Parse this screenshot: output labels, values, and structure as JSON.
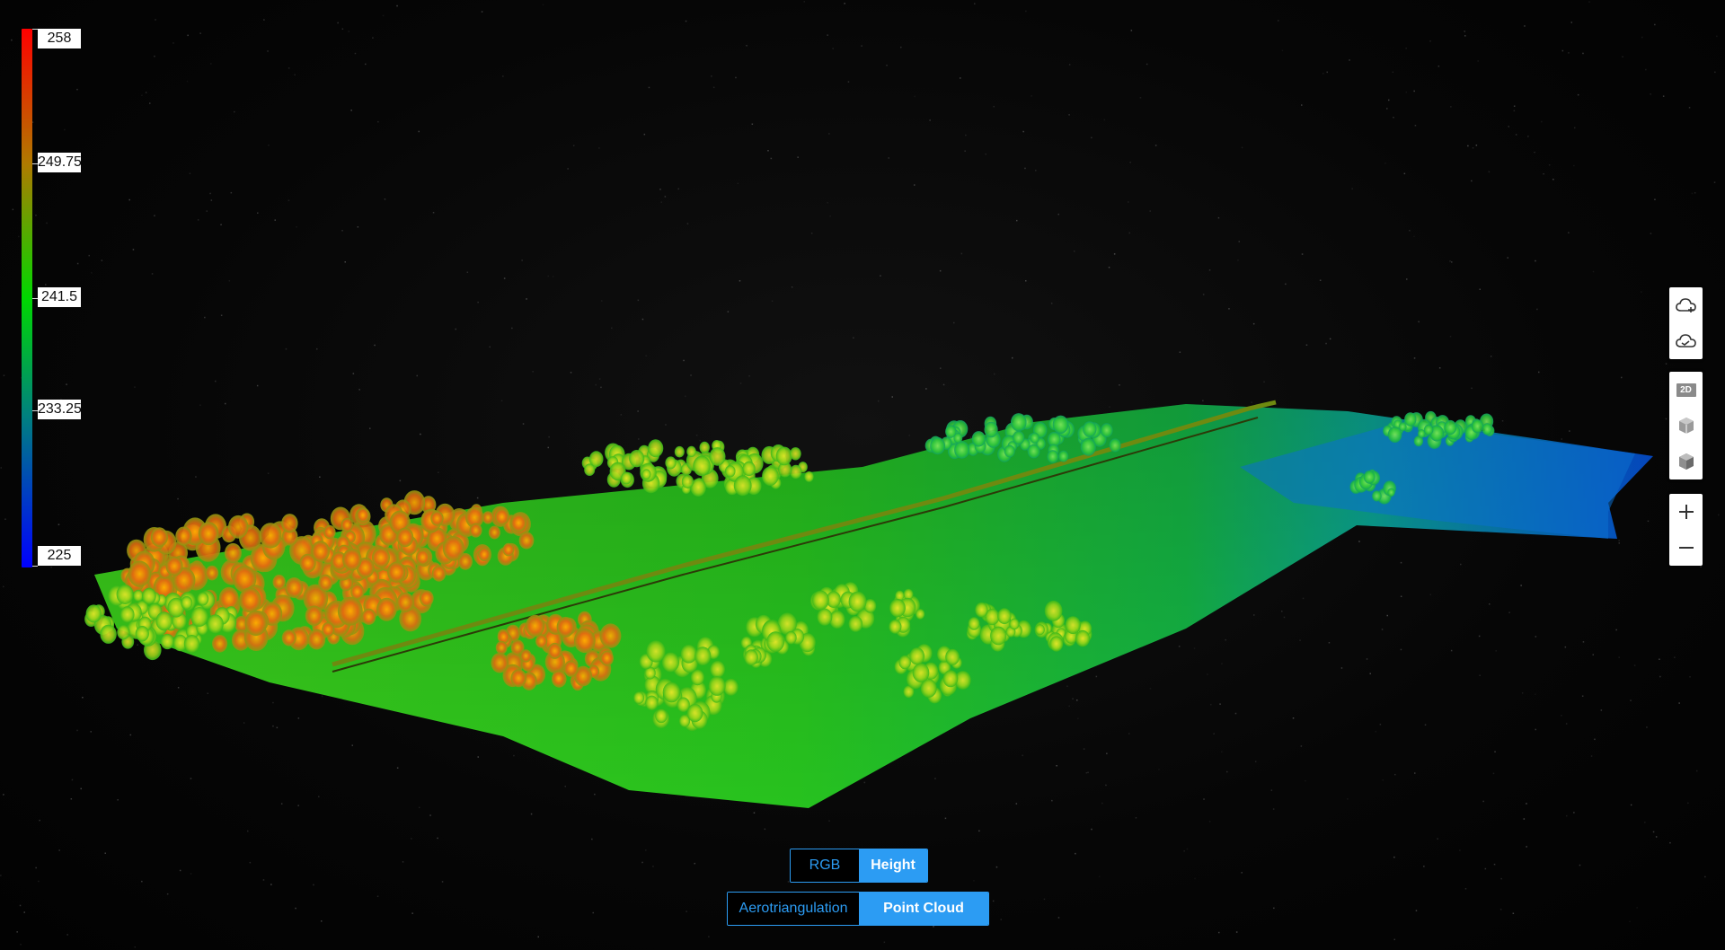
{
  "legend": {
    "labels": [
      "258",
      "249.75",
      "241.5",
      "233.25",
      "225"
    ],
    "colors": [
      "#ff0000",
      "#b07a00",
      "#00d800",
      "#008080",
      "#0000ff"
    ]
  },
  "toolbar": {
    "icons": [
      "cloud-add-icon",
      "cloud-check-icon",
      "2d-view-icon",
      "cube-icon",
      "cube-shaded-icon",
      "zoom-in-icon",
      "zoom-out-icon"
    ],
    "view_2d_label": "2D"
  },
  "color_mode": {
    "rgb_label": "RGB",
    "height_label": "Height",
    "selected": "Height"
  },
  "data_mode": {
    "aero_label": "Aerotriangulation",
    "pointcloud_label": "Point Cloud",
    "selected": "Point Cloud"
  },
  "colors": {
    "accent": "#2c9cf3",
    "background": "#050505"
  }
}
